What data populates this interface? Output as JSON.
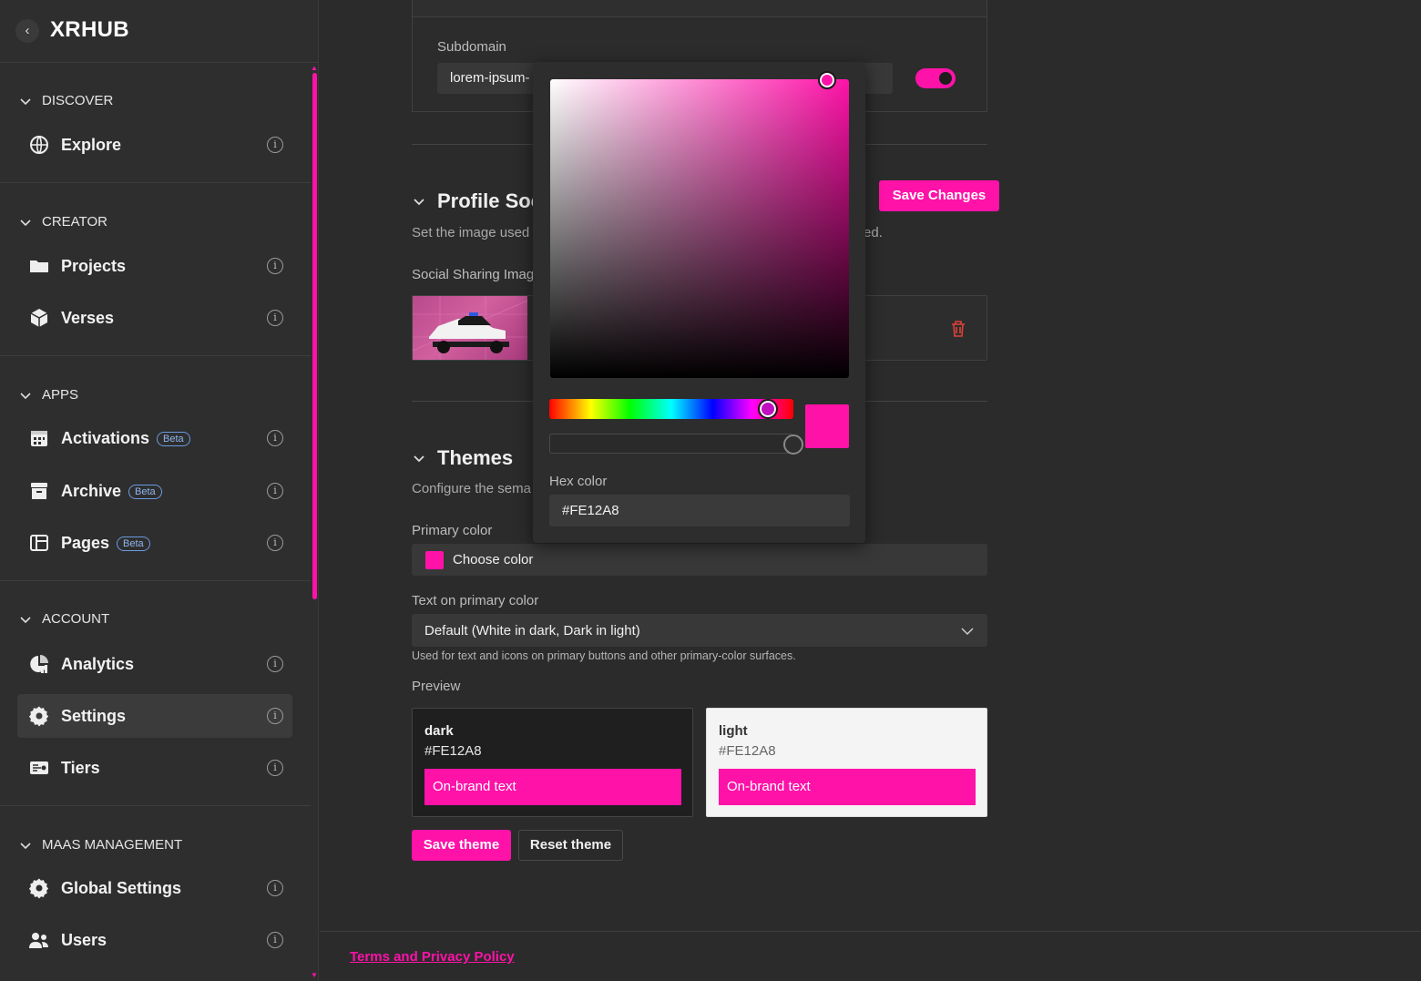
{
  "app": {
    "title": "XRHUB"
  },
  "sidebar": {
    "sections": [
      {
        "label": "DISCOVER",
        "items": [
          {
            "label": "Explore",
            "icon": "globe-icon"
          }
        ]
      },
      {
        "label": "CREATOR",
        "items": [
          {
            "label": "Projects",
            "icon": "folder-icon"
          },
          {
            "label": "Verses",
            "icon": "cube-icon"
          }
        ]
      },
      {
        "label": "APPS",
        "items": [
          {
            "label": "Activations",
            "badge": "Beta",
            "icon": "calendar-icon"
          },
          {
            "label": "Archive",
            "badge": "Beta",
            "icon": "archive-icon"
          },
          {
            "label": "Pages",
            "badge": "Beta",
            "icon": "layout-icon"
          }
        ]
      },
      {
        "label": "ACCOUNT",
        "items": [
          {
            "label": "Analytics",
            "icon": "chart-icon"
          },
          {
            "label": "Settings",
            "icon": "gear-icon",
            "active": true
          },
          {
            "label": "Tiers",
            "icon": "ticket-icon"
          }
        ]
      },
      {
        "label": "MAAS MANAGEMENT",
        "items": [
          {
            "label": "Global Settings",
            "icon": "gear-icon"
          },
          {
            "label": "Users",
            "icon": "users-icon"
          }
        ]
      }
    ],
    "info_glyph": "i"
  },
  "main": {
    "subdomain": {
      "label": "Subdomain",
      "value": "lorem-ipsum-",
      "enabled": true
    },
    "profile_social": {
      "title": "Profile Soc",
      "description": "Set the image used",
      "description_tail": "ed.",
      "save_button": "Save Changes",
      "image_label": "Social Sharing Imag"
    },
    "themes": {
      "title": "Themes",
      "description": "Configure the sema",
      "primary_color_label": "Primary color",
      "choose_color": "Choose color",
      "text_on_primary_label": "Text on primary color",
      "text_on_primary_value": "Default (White in dark, Dark in light)",
      "text_on_primary_note": "Used for text and icons on primary buttons and other primary-color surfaces.",
      "preview_label": "Preview",
      "preview_dark": {
        "name": "dark",
        "hex": "#FE12A8",
        "bar_text": "On-brand text"
      },
      "preview_light": {
        "name": "light",
        "hex": "#FE12A8",
        "bar_text": "On-brand text"
      },
      "save_theme": "Save theme",
      "reset_theme": "Reset theme"
    },
    "footer_link": "Terms and Privacy Policy"
  },
  "color_picker": {
    "hex_label": "Hex color",
    "hex_value": "#FE12A8"
  },
  "colors": {
    "accent": "#FE12A8",
    "bg": "#2B2B2B",
    "sidebar_bg": "#2E2E2E"
  }
}
